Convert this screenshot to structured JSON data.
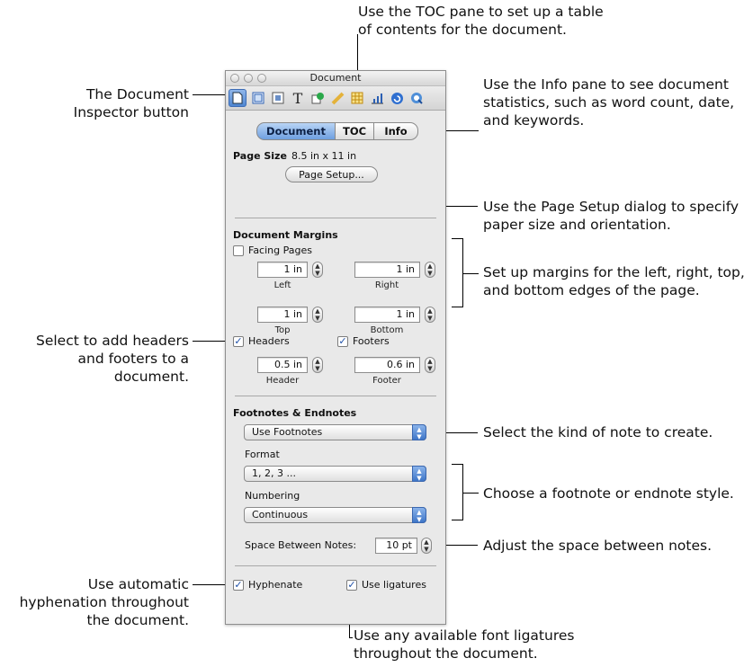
{
  "window": {
    "title": "Document",
    "tabs": [
      "Document",
      "TOC",
      "Info"
    ],
    "active_tab": "Document",
    "toolbar_icons": [
      "document-inspector-icon",
      "layout-inspector-icon",
      "wrap-inspector-icon",
      "text-inspector-icon",
      "graphic-inspector-icon",
      "metrics-inspector-icon",
      "table-inspector-icon",
      "chart-inspector-icon",
      "link-inspector-icon",
      "quicktime-inspector-icon"
    ]
  },
  "page_size": {
    "label": "Page Size",
    "value": "8.5 in x 11 in",
    "button": "Page Setup..."
  },
  "margins": {
    "heading": "Document Margins",
    "facing_pages": "Facing Pages",
    "facing_pages_checked": false,
    "left_value": "1 in",
    "left_label": "Left",
    "right_value": "1 in",
    "right_label": "Right",
    "top_value": "1 in",
    "top_label": "Top",
    "bottom_value": "1 in",
    "bottom_label": "Bottom"
  },
  "headers_footers": {
    "headers": "Headers",
    "headers_checked": true,
    "footers": "Footers",
    "footers_checked": true,
    "header_value": "0.5 in",
    "header_label": "Header",
    "footer_value": "0.6 in",
    "footer_label": "Footer"
  },
  "notes": {
    "heading": "Footnotes & Endnotes",
    "type": "Use Footnotes",
    "format_label": "Format",
    "format": "1, 2, 3 ...",
    "numbering_label": "Numbering",
    "numbering": "Continuous",
    "space_label": "Space Between Notes:",
    "space_value": "10 pt"
  },
  "bottom_options": {
    "hyphenate": "Hyphenate",
    "hyphenate_checked": true,
    "ligatures": "Use ligatures",
    "ligatures_checked": true
  },
  "callouts": {
    "toc": [
      "Use the TOC pane to set up a table",
      "of contents for the document."
    ],
    "doc_inspector": [
      "The Document",
      "Inspector button"
    ],
    "info": [
      "Use the Info pane to see document",
      "statistics, such as word count, date,",
      "and keywords."
    ],
    "page_setup": [
      "Use the Page Setup dialog to specify",
      "paper size and orientation."
    ],
    "margins": [
      "Set up margins for the left, right, top,",
      "and bottom edges of the page."
    ],
    "headers": [
      "Select to add headers",
      "and footers to a",
      "document."
    ],
    "note_kind": [
      "Select the kind of note to create."
    ],
    "note_style": [
      "Choose a footnote or endnote style."
    ],
    "spacing": [
      "Adjust the space between notes."
    ],
    "hyphenation": [
      "Use automatic",
      "hyphenation throughout",
      "the document."
    ],
    "ligatures": [
      "Use any available font ligatures",
      "throughout the document."
    ]
  },
  "colors": {
    "selection_blue": "#4f86d2",
    "checkmark_blue": "#1e4fa8",
    "window_bg": "#e9e9e9"
  }
}
